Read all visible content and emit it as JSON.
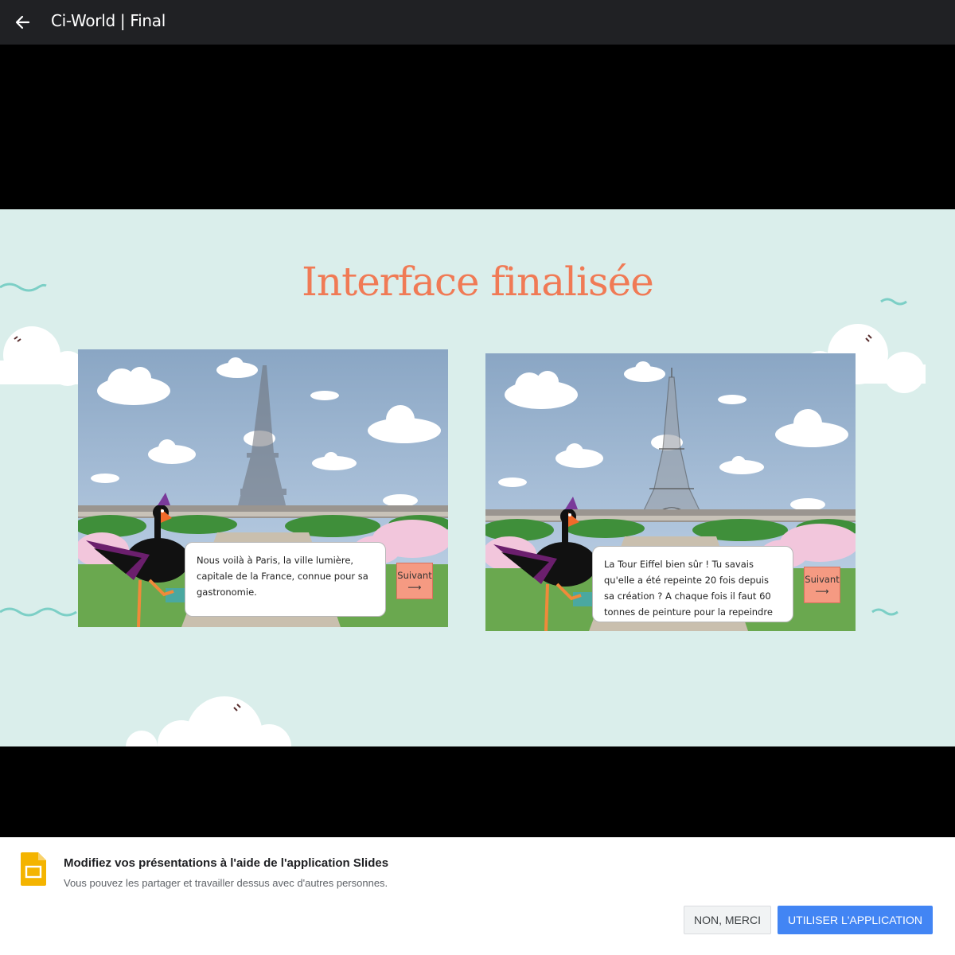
{
  "topbar": {
    "title": "Ci-World | Final"
  },
  "slide": {
    "title": "Interface finalisée",
    "screens": [
      {
        "dialog": "Nous voilà à Paris, la ville lumière, capitale de la France, connue pour sa gastronomie.",
        "button": "Suivant",
        "arrow": "⟶"
      },
      {
        "dialog": "La Tour Eiffel bien sûr ! Tu savais qu'elle a été repeinte 20 fois depuis sa création ? A chaque fois il faut 60 tonnes de peinture pour la repeindre entièrement, soit le",
        "button": "Suivant",
        "arrow": "⟶"
      }
    ]
  },
  "banner": {
    "title": "Modifiez vos présentations à l'aide de l'application Slides",
    "subtitle": "Vous pouvez les partager et travailler dessus avec d'autres personnes.",
    "decline": "NON, MERCI",
    "accept": "UTILISER L'APPLICATION"
  },
  "colors": {
    "accent": "#f07a55",
    "slide_bg": "#daeeeb",
    "primary_button": "#4285f4",
    "slides_icon": "#f4b400"
  },
  "icons": {
    "back": "arrow-left-icon",
    "app": "google-slides-icon"
  }
}
